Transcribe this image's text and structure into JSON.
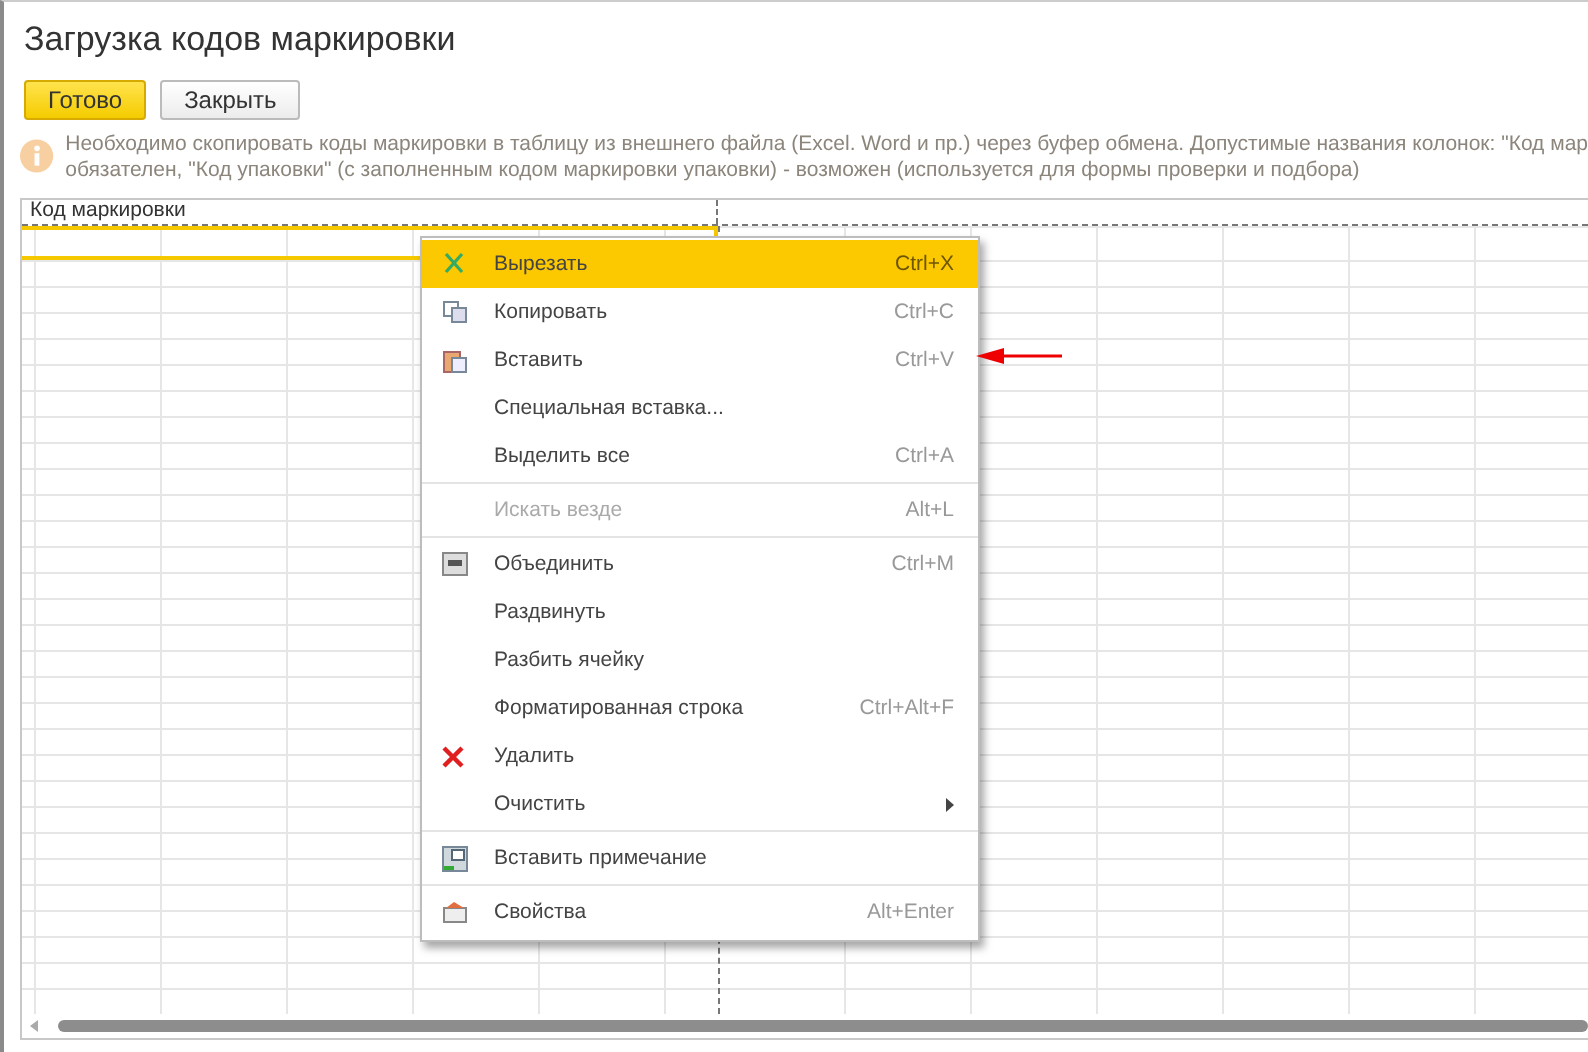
{
  "window": {
    "title": "Загрузка кодов маркировки"
  },
  "buttons": [
    {
      "label": "Готово",
      "kind": "primary"
    },
    {
      "label": "Закрыть",
      "kind": "default"
    }
  ],
  "info": {
    "lines": [
      "Необходимо скопировать коды маркировки в таблицу из внешнего файла (Excel. Word и пр.) через буфер обмена. Допустимые названия колонок: \"Код мар",
      "обязателен, \"Код упаковки\" (с заполненным кодом маркировки упаковки) - возможен (используется для формы проверки и подбора)"
    ]
  },
  "table": {
    "columns": [
      "Код маркировки"
    ]
  },
  "context_menu": {
    "items": [
      {
        "kind": "item",
        "label": "Вырезать",
        "shortcut": "Ctrl+X",
        "selected": true,
        "disabled": false
      },
      {
        "kind": "item",
        "label": "Копировать",
        "shortcut": "Ctrl+C",
        "selected": false,
        "disabled": false
      },
      {
        "kind": "item",
        "label": "Вставить",
        "shortcut": "Ctrl+V",
        "selected": false,
        "disabled": false
      },
      {
        "kind": "item",
        "label": "Специальная вставка...",
        "selected": false,
        "disabled": false
      },
      {
        "kind": "item",
        "label": "Выделить все",
        "shortcut": "Ctrl+A",
        "selected": false,
        "disabled": false
      },
      {
        "kind": "separator"
      },
      {
        "kind": "item",
        "label": "Искать везде",
        "shortcut": "Alt+L",
        "selected": false,
        "disabled": true
      },
      {
        "kind": "separator"
      },
      {
        "kind": "item",
        "label": "Объединить",
        "shortcut": "Ctrl+M",
        "selected": false,
        "disabled": false
      },
      {
        "kind": "item",
        "label": "Раздвинуть",
        "selected": false,
        "disabled": false
      },
      {
        "kind": "item",
        "label": "Разбить ячейку",
        "selected": false,
        "disabled": false
      },
      {
        "kind": "item",
        "label": "Форматированная строка",
        "shortcut": "Ctrl+Alt+F",
        "selected": false,
        "disabled": false
      },
      {
        "kind": "item",
        "label": "Удалить",
        "selected": false,
        "disabled": false
      },
      {
        "kind": "submenu",
        "label": "Очистить",
        "selected": false,
        "disabled": false
      },
      {
        "kind": "separator"
      },
      {
        "kind": "item",
        "label": "Вставить примечание",
        "selected": false,
        "disabled": false
      },
      {
        "kind": "separator"
      },
      {
        "kind": "item",
        "label": "Свойства",
        "shortcut": "Alt+Enter",
        "selected": false,
        "disabled": false
      }
    ]
  }
}
